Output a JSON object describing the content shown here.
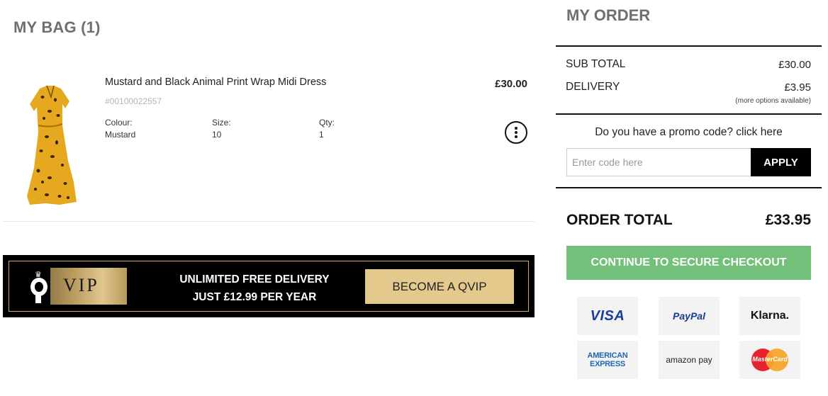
{
  "bag": {
    "title": "MY BAG (1)",
    "item": {
      "name": "Mustard and Black Animal Print Wrap Midi Dress",
      "sku": "#00100022557",
      "price": "£30.00",
      "colour_label": "Colour:",
      "colour_value": "Mustard",
      "size_label": "Size:",
      "size_value": "10",
      "qty_label": "Qty:",
      "qty_value": "1",
      "image_icon": "mustard-leopard-dress-image"
    }
  },
  "vip": {
    "logo_text": "VIP",
    "line1": "UNLIMITED FREE DELIVERY",
    "line2": "JUST £12.99 PER YEAR",
    "button_label": "BECOME A QVIP"
  },
  "order": {
    "title": "MY ORDER",
    "subtotal_label": "SUB TOTAL",
    "subtotal_value": "£30.00",
    "delivery_label": "DELIVERY",
    "delivery_value": "£3.95",
    "delivery_note": "(more options available)",
    "promo_question": "Do you have a promo code? click here",
    "promo_placeholder": "Enter code here",
    "apply_label": "APPLY",
    "total_label": "ORDER TOTAL",
    "total_value": "£33.95",
    "checkout_label": "CONTINUE TO SECURE CHECKOUT"
  },
  "payment_methods": {
    "visa": "VISA",
    "paypal": "PayPal",
    "klarna": "Klarna.",
    "amex_line1": "AMERICAN",
    "amex_line2": "EXPRESS",
    "amazon": "amazon pay",
    "mastercard": "MasterCard"
  },
  "colors": {
    "checkout_green": "#73c07a",
    "vip_gold": "#e3c98c",
    "heading_grey": "#6f6f6f"
  }
}
